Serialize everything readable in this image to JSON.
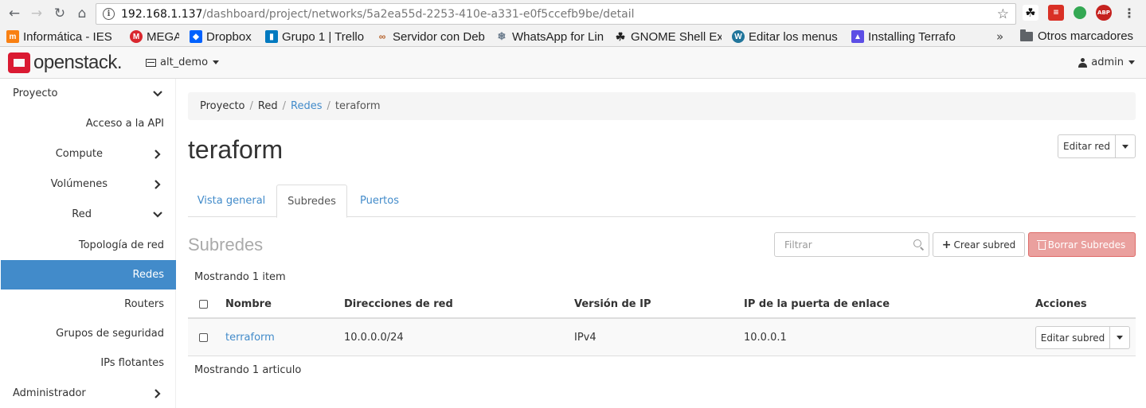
{
  "browser": {
    "url_host": "192.168.1.137",
    "url_path": "/dashboard/project/networks/5a2ea55d-2253-410e-a331-e0f5ccefb9be/detail",
    "bookmarks": [
      {
        "label": "Informática - IES",
        "icon": "moodle-icon",
        "color": "#f98012"
      },
      {
        "label": "MEGA",
        "icon": "mega-icon",
        "color": "#d9272e"
      },
      {
        "label": "Dropbox",
        "icon": "dropbox-icon",
        "color": "#0061fe"
      },
      {
        "label": "Grupo 1 | Trello",
        "icon": "trello-icon",
        "color": "#0079bf"
      },
      {
        "label": "Servidor con Deb",
        "icon": "link-icon",
        "color": "#b5612a"
      },
      {
        "label": "WhatsApp for Lin",
        "icon": "gnu-icon",
        "color": "#6a7b8c"
      },
      {
        "label": "GNOME Shell Ext",
        "icon": "gnome-icon",
        "color": "#222222"
      },
      {
        "label": "Editar los menus",
        "icon": "wordpress-icon",
        "color": "#21759b"
      },
      {
        "label": "Installing Terrafo",
        "icon": "terraform-icon",
        "color": "#5c4ee5"
      }
    ],
    "more_bookmarks": "»",
    "other_bookmarks": "Otros marcadores"
  },
  "header": {
    "logo_text": "openstack.",
    "project": "alt_demo",
    "user": "admin"
  },
  "sidebar": {
    "items": [
      {
        "label": "Proyecto",
        "level": "cat",
        "chevron": "down"
      },
      {
        "label": "Acceso a la API",
        "level": "sub"
      },
      {
        "label": "Compute",
        "level": "sub",
        "chevron": "right"
      },
      {
        "label": "Volúmenes",
        "level": "sub",
        "chevron": "right"
      },
      {
        "label": "Red",
        "level": "sub",
        "chevron": "down"
      },
      {
        "label": "Topología de red",
        "level": "sub2"
      },
      {
        "label": "Redes",
        "level": "sub2",
        "active": true
      },
      {
        "label": "Routers",
        "level": "sub2"
      },
      {
        "label": "Grupos de seguridad",
        "level": "sub2"
      },
      {
        "label": "IPs flotantes",
        "level": "sub2"
      },
      {
        "label": "Administrador",
        "level": "cat",
        "chevron": "right"
      }
    ]
  },
  "breadcrumb": [
    "Proyecto",
    "Red",
    "Redes",
    "teraform"
  ],
  "page_title": "teraform",
  "edit_network_label": "Editar red",
  "tabs": [
    {
      "label": "Vista general"
    },
    {
      "label": "Subredes",
      "active": true
    },
    {
      "label": "Puertos"
    }
  ],
  "section_title": "Subredes",
  "filter_placeholder": "Filtrar",
  "create_subnet_label": "Crear subred",
  "delete_subnets_label": "Borrar Subredes",
  "count_top": "Mostrando 1 item",
  "count_bottom": "Mostrando 1 articulo",
  "table": {
    "columns": [
      "Nombre",
      "Direcciones de red",
      "Versión de IP",
      "IP de la puerta de enlace",
      "Acciones"
    ],
    "rows": [
      {
        "name": "terraform",
        "cidr": "10.0.0.0/24",
        "ip_version": "IPv4",
        "gateway": "10.0.0.1",
        "action": "Editar subred"
      }
    ]
  }
}
